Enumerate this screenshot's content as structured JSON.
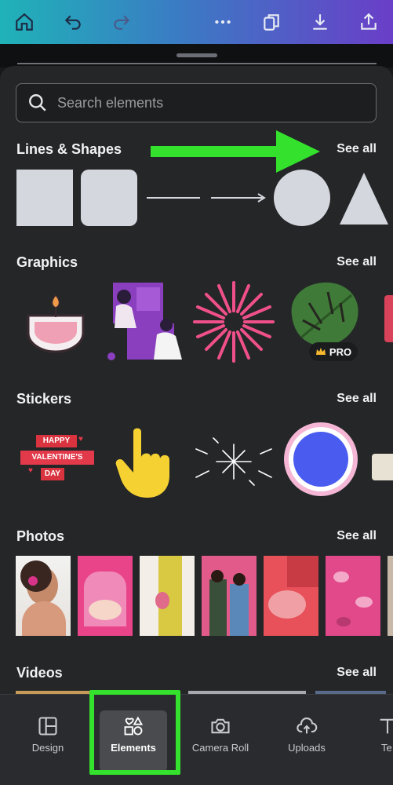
{
  "toolbar": {
    "icons": [
      "home-icon",
      "undo-icon",
      "redo-icon",
      "more-icon",
      "pages-icon",
      "download-icon",
      "share-icon"
    ]
  },
  "search": {
    "placeholder": "Search elements"
  },
  "sections": {
    "lines_shapes": {
      "title": "Lines & Shapes",
      "see_all": "See all"
    },
    "graphics": {
      "title": "Graphics",
      "see_all": "See all",
      "pro_label": "PRO"
    },
    "stickers": {
      "title": "Stickers",
      "see_all": "See all",
      "valentine": {
        "line1": "HAPPY",
        "line2": "VALENTINE'S",
        "line3": "DAY"
      }
    },
    "photos": {
      "title": "Photos",
      "see_all": "See all"
    },
    "videos": {
      "title": "Videos",
      "see_all": "See all"
    }
  },
  "bottom_nav": {
    "items": [
      {
        "label": "Design",
        "icon": "layout-icon"
      },
      {
        "label": "Elements",
        "icon": "shapes-icon",
        "active": true
      },
      {
        "label": "Camera Roll",
        "icon": "camera-icon"
      },
      {
        "label": "Uploads",
        "icon": "cloud-upload-icon"
      },
      {
        "label": "Te",
        "icon": "text-icon"
      }
    ]
  },
  "colors": {
    "accent_annotation": "#34e12c",
    "panel": "#252628",
    "shape_fill": "#d4d8de"
  }
}
